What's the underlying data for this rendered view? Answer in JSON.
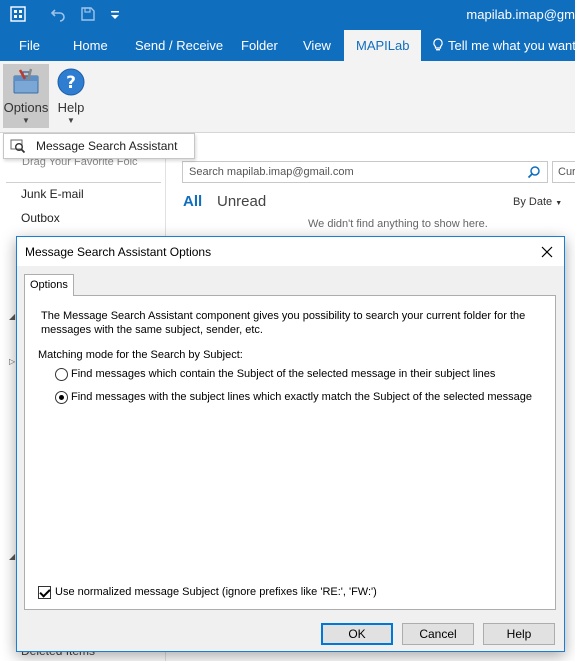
{
  "titlebar": {
    "account": "mapilab.imap@gm",
    "quick_access": [
      "send-receive-all-icon",
      "undo-icon",
      "save-icon",
      "customize-icon"
    ]
  },
  "ribbon_tabs": [
    {
      "label": "File"
    },
    {
      "label": "Home"
    },
    {
      "label": "Send / Receive"
    },
    {
      "label": "Folder"
    },
    {
      "label": "View"
    },
    {
      "label": "MAPILab",
      "active": true
    },
    {
      "label": "Tell me what you want"
    }
  ],
  "ribbon": {
    "options_label": "Options",
    "help_label": "Help"
  },
  "menu": {
    "item_label": "Message Search Assistant"
  },
  "folder_pane": {
    "drag_hint": "Drag Your Favorite Folc",
    "items": [
      "Junk E-mail",
      "Outbox",
      "Deleted Items"
    ]
  },
  "mail": {
    "search_placeholder": "Search mapilab.imap@gmail.com",
    "scope_label": "Cur",
    "filter_all": "All",
    "filter_unread": "Unread",
    "sort_label": "By Date",
    "empty_message": "We didn't find anything to show here."
  },
  "dialog": {
    "title": "Message Search Assistant Options",
    "tab_label": "Options",
    "description": "The Message Search Assistant component gives you possibility to search your current folder for the messages with the same subject, sender, etc.",
    "matching_label": "Matching mode for the Search by Subject:",
    "radio_contain": "Find messages which contain the Subject of the selected message in their subject lines",
    "radio_exact": "Find messages with the subject lines which exactly match the Subject of the selected message",
    "selected_mode": "exact",
    "normalize_label": "Use normalized message Subject (ignore prefixes like 'RE:', 'FW:')",
    "normalize_checked": true,
    "ok_label": "OK",
    "cancel_label": "Cancel",
    "help_label": "Help"
  },
  "colors": {
    "brand_blue": "#106ebe",
    "dialog_border": "#1a7fd4",
    "default_button_border": "#0078d7"
  }
}
